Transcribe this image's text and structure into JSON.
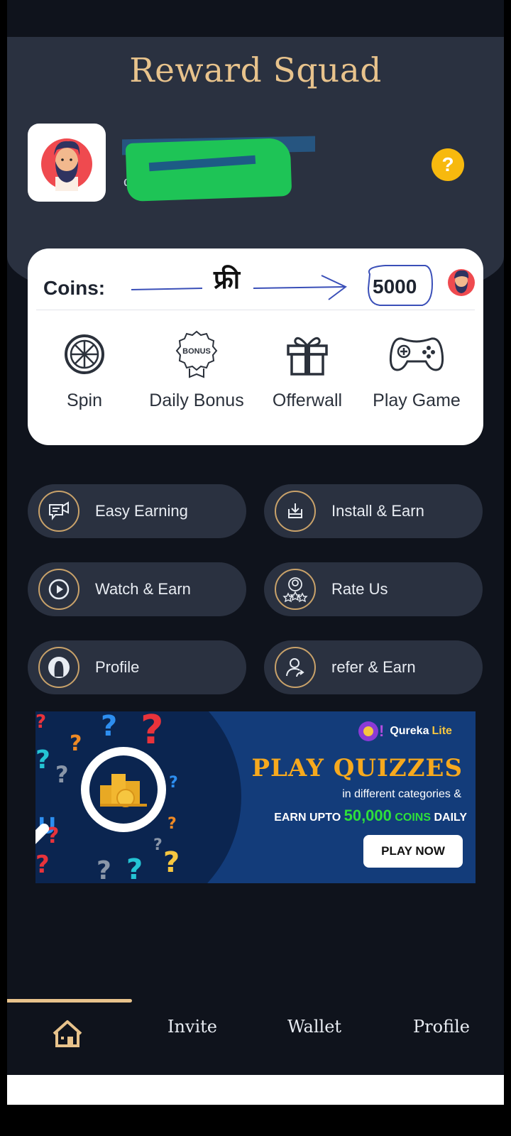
{
  "app": {
    "title": "Reward Squad"
  },
  "user": {
    "name": "C",
    "email": "d  m    .com",
    "help_icon": "question-mark-icon",
    "help_label": "?"
  },
  "coins_card": {
    "label": "Coins:",
    "annotation": "फ्री",
    "value": "5000",
    "actions": [
      {
        "label": "Spin",
        "icon": "spin-wheel-icon"
      },
      {
        "label": "Daily Bonus",
        "icon": "bonus-badge-icon"
      },
      {
        "label": "Offerwall",
        "icon": "gift-icon"
      },
      {
        "label": "Play Game",
        "icon": "gamepad-icon"
      }
    ]
  },
  "menu": [
    {
      "label": "Easy Earning",
      "icon": "megaphone-chat-icon"
    },
    {
      "label": "Install & Earn",
      "icon": "download-tray-icon"
    },
    {
      "label": "Watch & Earn",
      "icon": "play-circle-icon"
    },
    {
      "label": "Rate Us",
      "icon": "user-stars-icon"
    },
    {
      "label": "Profile",
      "icon": "profile-silhouette-icon"
    },
    {
      "label": "refer & Earn",
      "icon": "user-share-icon"
    }
  ],
  "ad": {
    "brand": "Qureka",
    "brand_suffix": "Lite",
    "headline": "PLAY QUIZZES",
    "subline": "in different categories &",
    "earn_prefix": "EARN UPTO",
    "earn_amount": "50,000",
    "earn_unit": "COINS",
    "earn_suffix": "DAILY",
    "cta": "PLAY NOW"
  },
  "bottom_nav": {
    "active": "home",
    "items": [
      {
        "id": "home",
        "icon": "home-icon",
        "label": ""
      },
      {
        "id": "invite",
        "label": "Invite"
      },
      {
        "id": "wallet",
        "label": "Wallet"
      },
      {
        "id": "profile",
        "label": "Profile"
      }
    ]
  },
  "colors": {
    "accent_gold": "#e8c38c",
    "panel": "#2a3140",
    "background": "#0f131c",
    "help_yellow": "#f7b90e",
    "ad_blue": "#133c7a",
    "ad_green": "#2ee03a",
    "ad_orange": "#f6a91e"
  }
}
